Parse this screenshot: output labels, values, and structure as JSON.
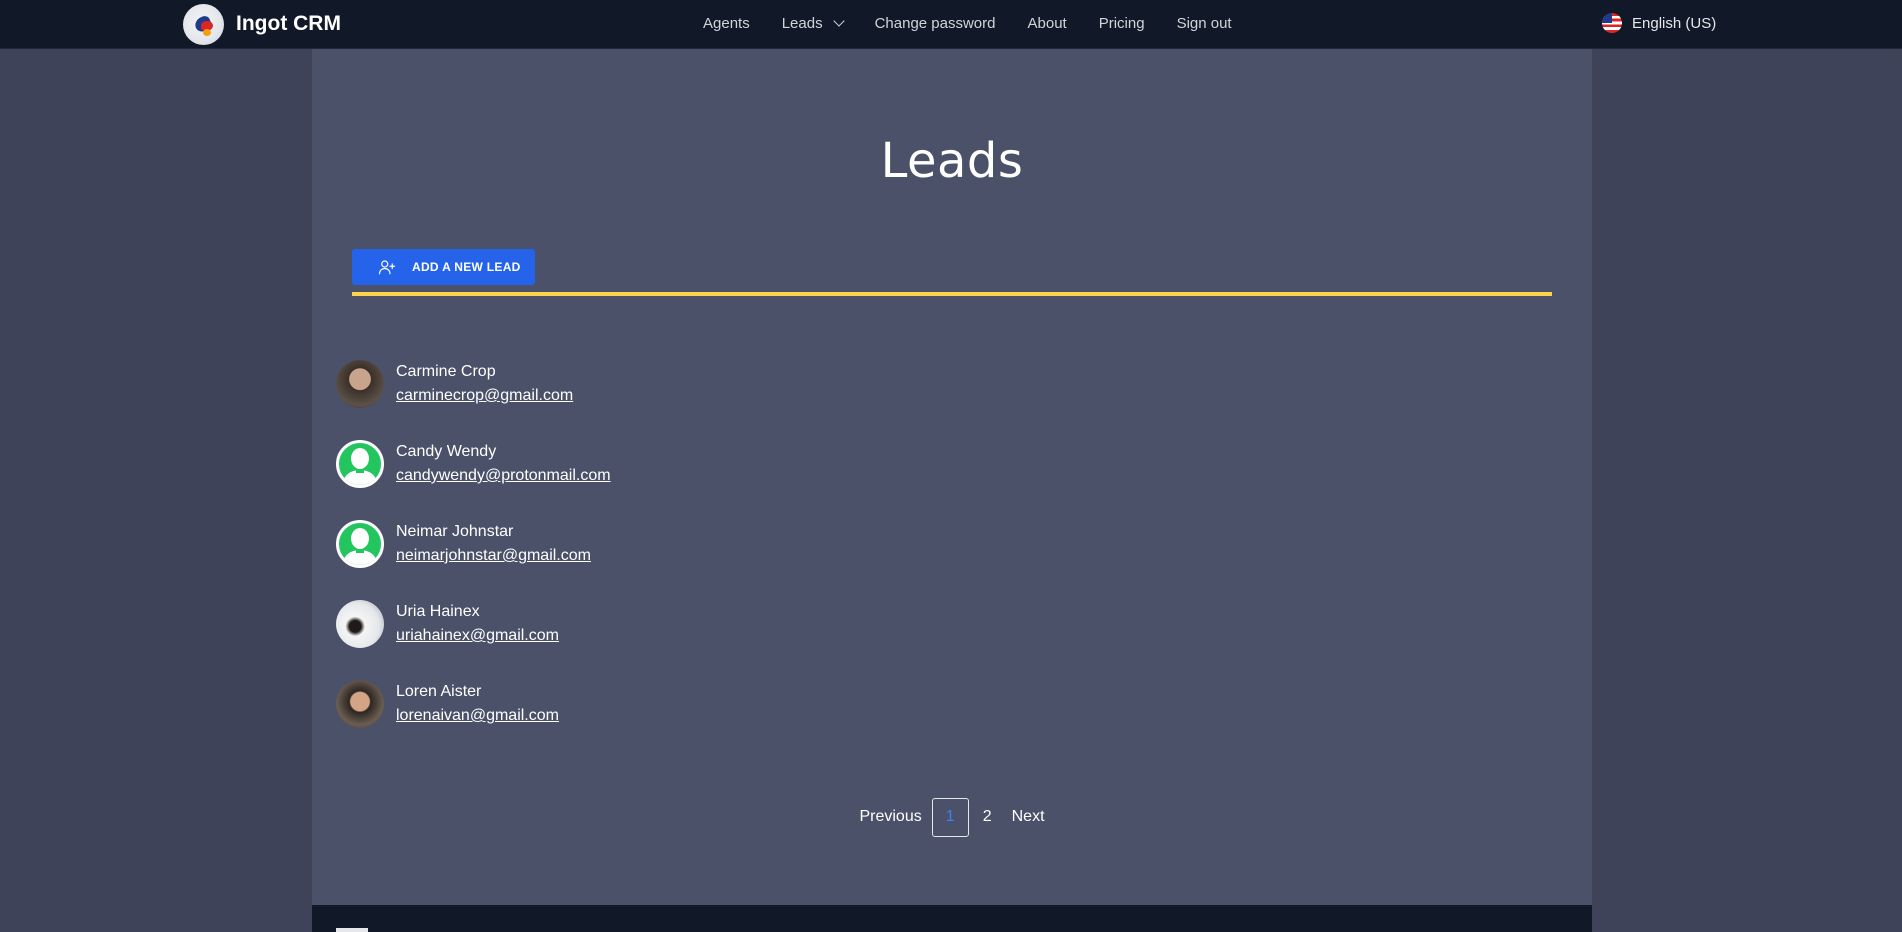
{
  "app": {
    "name": "Ingot CRM"
  },
  "nav": {
    "items": [
      {
        "label": "Agents"
      },
      {
        "label": "Leads"
      },
      {
        "label": "Change password"
      },
      {
        "label": "About"
      },
      {
        "label": "Pricing"
      },
      {
        "label": "Sign out"
      }
    ],
    "language": "English (US)"
  },
  "page": {
    "title": "Leads",
    "add_button": "ADD A NEW LEAD"
  },
  "leads": [
    {
      "name": "Carmine Crop",
      "email": "carminecrop@gmail.com",
      "avatar": "photo"
    },
    {
      "name": "Candy Wendy",
      "email": "candywendy@protonmail.com",
      "avatar": "generic-user-icon"
    },
    {
      "name": "Neimar Johnstar",
      "email": "neimarjohnstar@gmail.com",
      "avatar": "generic-user-icon"
    },
    {
      "name": "Uria Hainex",
      "email": "uriahainex@gmail.com",
      "avatar": "photo"
    },
    {
      "name": "Loren Aister",
      "email": "lorenaivan@gmail.com",
      "avatar": "photo"
    }
  ],
  "pagination": {
    "previous": "Previous",
    "pages": [
      "1",
      "2"
    ],
    "current": "1",
    "next": "Next"
  },
  "colors": {
    "navbar_bg": "#111827",
    "page_bg": "#3f435a",
    "panel_bg": "#4a5169",
    "accent": "#2563eb",
    "divider": "#fcd34d",
    "avatar_generic": "#22c55e"
  }
}
